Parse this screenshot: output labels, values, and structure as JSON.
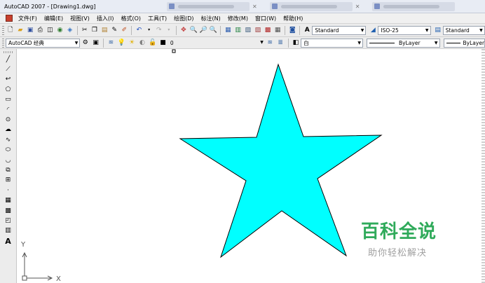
{
  "window": {
    "title": "AutoCAD 2007 - [Drawing1.dwg]"
  },
  "menu": [
    "文件(F)",
    "编辑(E)",
    "视图(V)",
    "插入(I)",
    "格式(O)",
    "工具(T)",
    "绘图(D)",
    "标注(N)",
    "修改(M)",
    "窗口(W)",
    "帮助(H)"
  ],
  "toolbar": {
    "text_style": "Standard",
    "dim_style": "ISO-25",
    "table_style": "Standard",
    "workspace": "AutoCAD 经典",
    "layer": "0",
    "color": "白",
    "linetype": "ByLayer",
    "lineweight": "ByLayer"
  },
  "ucs": {
    "y_label": "Y",
    "x_label": "X"
  },
  "watermark": {
    "title": "百科全说",
    "subtitle": "助你轻松解决"
  },
  "colors": {
    "star_fill": "#00ffff",
    "watermark_green": "#2faa5a"
  },
  "drawing": {
    "shape": "five-pointed star",
    "fill": "cyan"
  }
}
